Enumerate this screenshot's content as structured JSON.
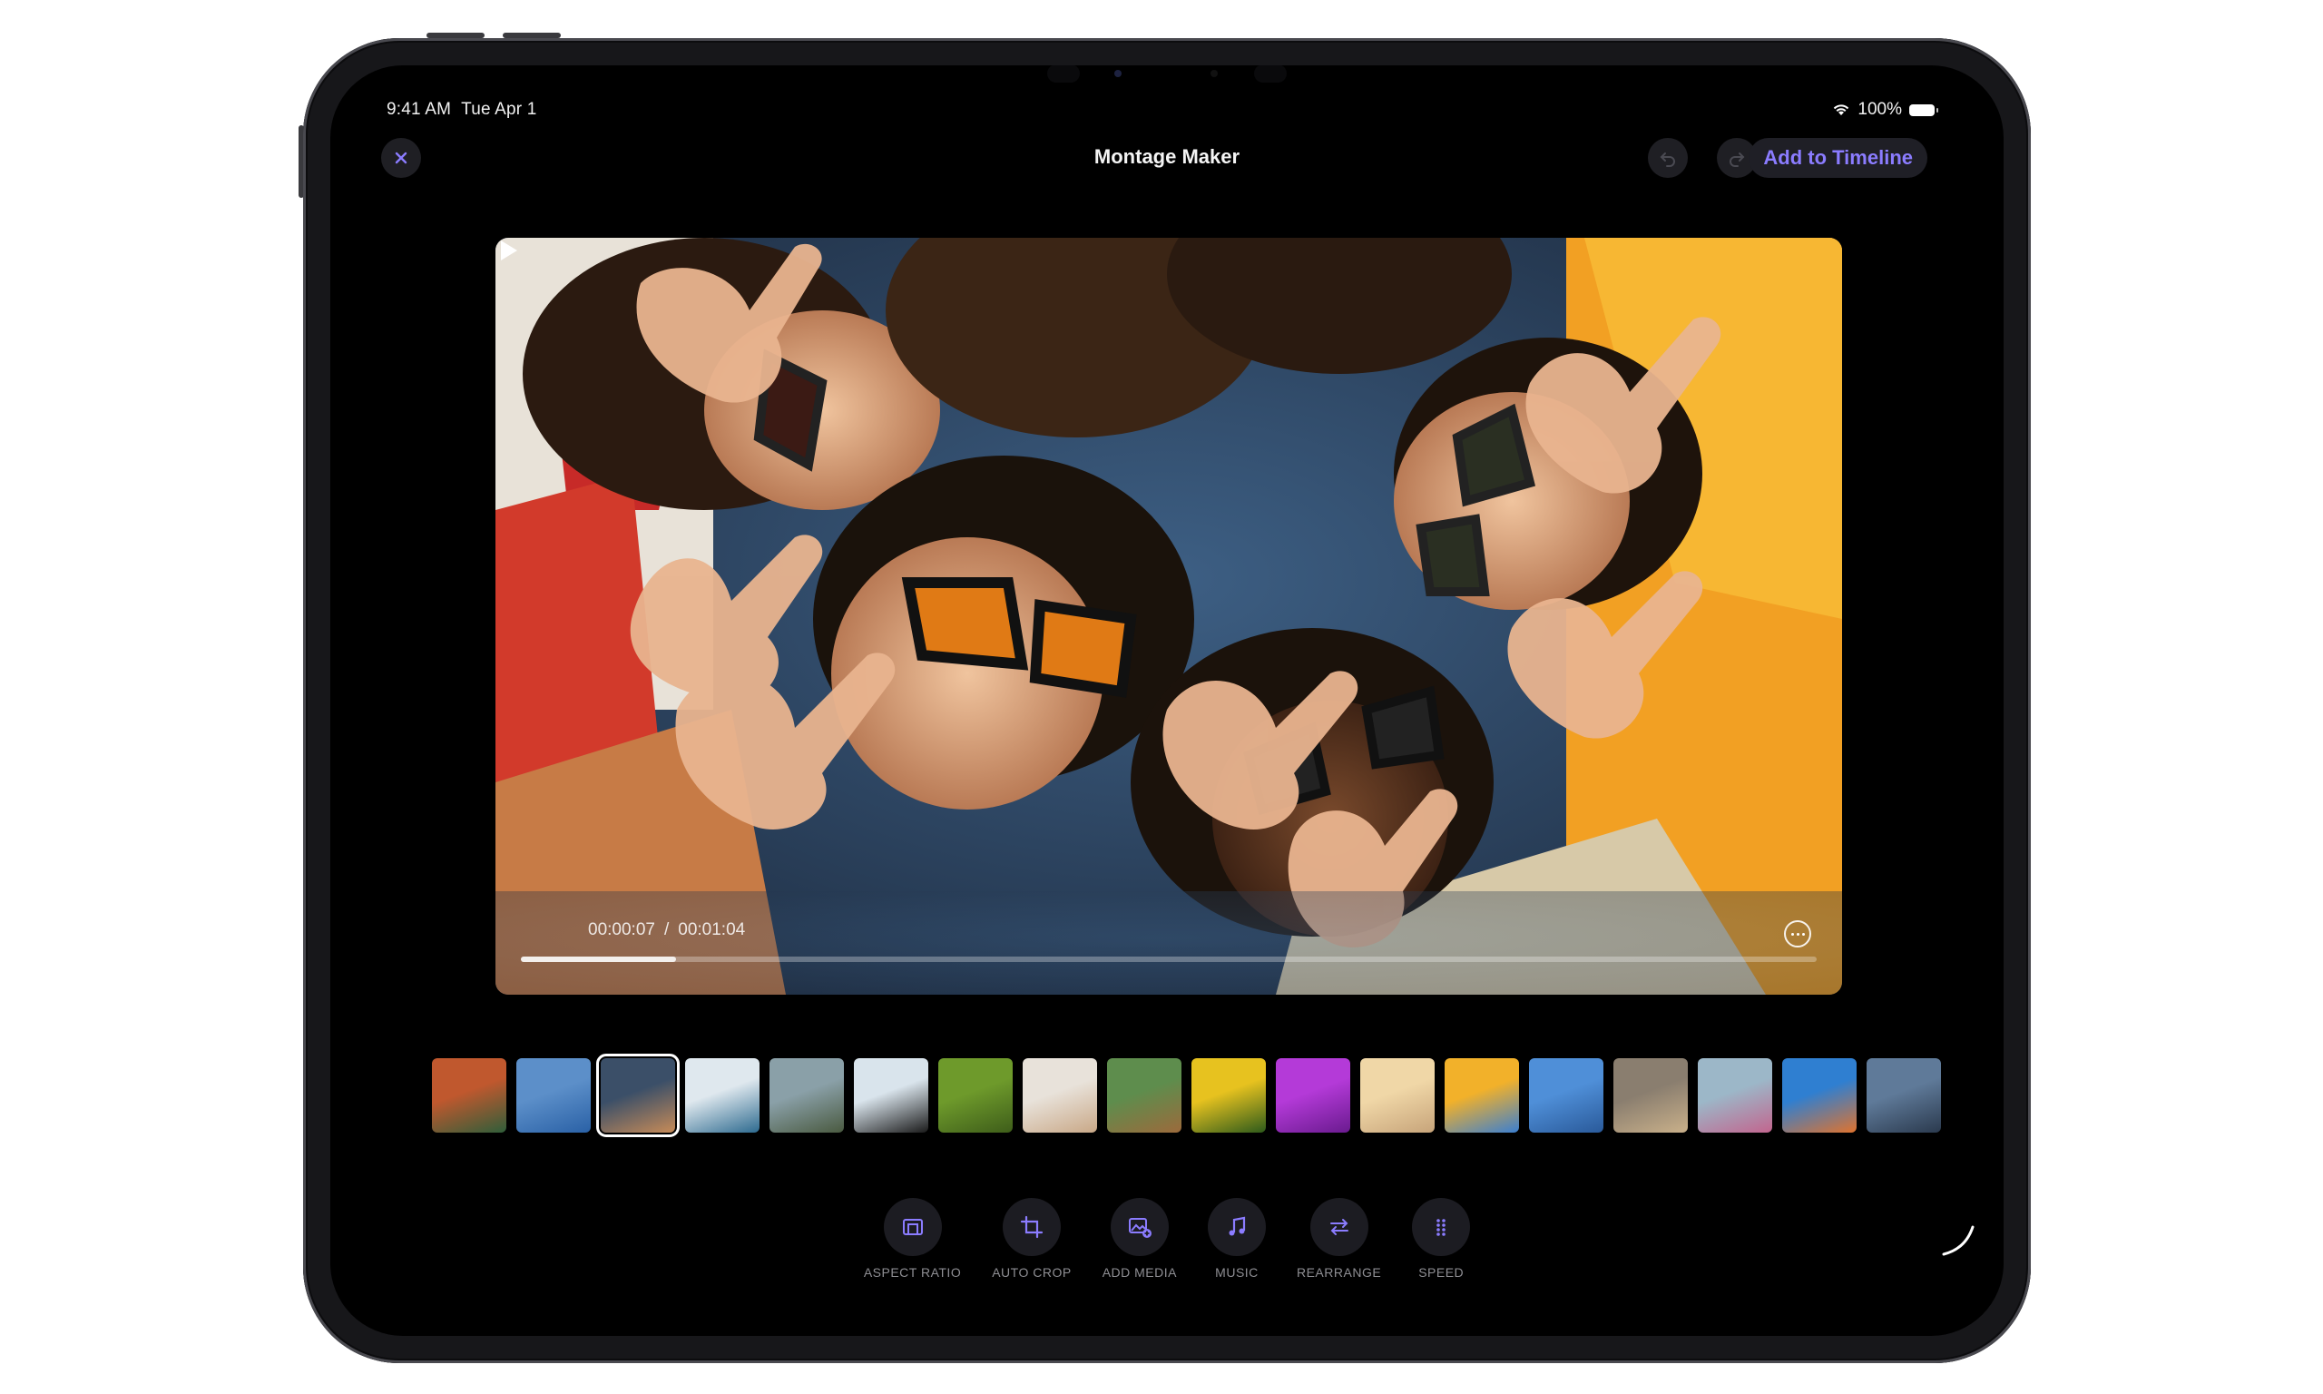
{
  "status": {
    "time": "9:41 AM",
    "date": "Tue Apr 1",
    "battery": "100%"
  },
  "nav": {
    "title": "Montage Maker",
    "add_label": "Add to Timeline"
  },
  "player": {
    "current": "00:00:07",
    "separator": "/",
    "total": "00:01:04",
    "progress": 0.12
  },
  "strip": {
    "selected_index": 2,
    "thumbnails": [
      {
        "colors": [
          "#c0582e",
          "#2f5e3a"
        ]
      },
      {
        "colors": [
          "#5c8fc9",
          "#2a61a6"
        ]
      },
      {
        "colors": [
          "#3b4f68",
          "#c78b58"
        ]
      },
      {
        "colors": [
          "#dfe8ee",
          "#2d6a8f"
        ]
      },
      {
        "colors": [
          "#8aa0a8",
          "#4a5a40"
        ]
      },
      {
        "colors": [
          "#d9e4ec",
          "#1a1a1a"
        ]
      },
      {
        "colors": [
          "#6e9a2b",
          "#3e5d1a"
        ]
      },
      {
        "colors": [
          "#e8e2da",
          "#c9a887"
        ]
      },
      {
        "colors": [
          "#5e8d4d",
          "#9c6a3c"
        ]
      },
      {
        "colors": [
          "#e7c21f",
          "#2d5a1b"
        ]
      },
      {
        "colors": [
          "#b43ad8",
          "#6a1b8f"
        ]
      },
      {
        "colors": [
          "#f0d7a7",
          "#c7a47a"
        ]
      },
      {
        "colors": [
          "#f2b12a",
          "#3b7fd1"
        ]
      },
      {
        "colors": [
          "#4f8fd8",
          "#2a5a9a"
        ]
      },
      {
        "colors": [
          "#8a7e6f",
          "#c9b08a"
        ]
      },
      {
        "colors": [
          "#9cb7c8",
          "#c2658e"
        ]
      },
      {
        "colors": [
          "#2f7fd1",
          "#e0732e"
        ]
      },
      {
        "colors": [
          "#5f7a99",
          "#2b3a4e"
        ]
      }
    ]
  },
  "toolbar": [
    {
      "label": "ASPECT RATIO",
      "icon": "aspect-ratio-icon"
    },
    {
      "label": "AUTO CROP",
      "icon": "crop-icon"
    },
    {
      "label": "ADD MEDIA",
      "icon": "add-media-icon"
    },
    {
      "label": "MUSIC",
      "icon": "music-icon"
    },
    {
      "label": "REARRANGE",
      "icon": "rearrange-icon"
    },
    {
      "label": "SPEED",
      "icon": "speed-icon"
    }
  ],
  "colors": {
    "accent": "#8b7cff",
    "tool_icon": "#8b7cff"
  }
}
